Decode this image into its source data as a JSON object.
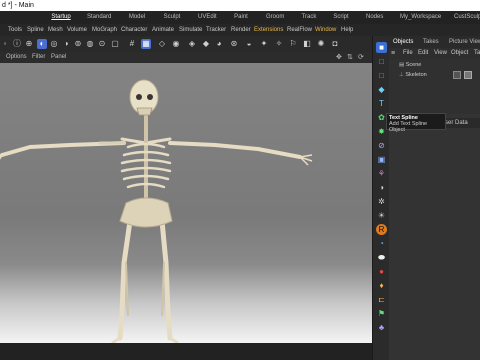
{
  "window": {
    "title": "d *] - Main"
  },
  "layout_tabs": [
    "Startup",
    "Standard",
    "Model",
    "Sculpt",
    "UVEdit",
    "Paint",
    "Groom",
    "Track",
    "Script",
    "Nodes",
    "My_Workspace",
    "CustSculpt"
  ],
  "active_layout": "Startup",
  "menu": [
    "Tools",
    "Spline",
    "Mesh",
    "Volume",
    "MoGraph",
    "Character",
    "Animate",
    "Simulate",
    "Tracker",
    "Render",
    "Extensions",
    "RealFlow",
    "Window",
    "Help"
  ],
  "viewport_menu": [
    "Options",
    "Filter",
    "Panel"
  ],
  "right_panel": {
    "tabs": [
      "Objects",
      "Takes",
      "Picture Viewer"
    ],
    "menu": [
      "File",
      "Edit",
      "View",
      "Object",
      "Ta"
    ],
    "objects": [
      {
        "name": "Scene"
      },
      {
        "name": "Skeleton"
      }
    ],
    "attr_label": "ser Data"
  },
  "tooltip": {
    "title": "Text Spline",
    "desc": "Add Text Spline Object"
  },
  "colors": {
    "accent": "#4a6fd0",
    "highlight_menu": "#e8b84a",
    "viewport_bg": "#7e7e7e",
    "bone": "#e6dcc4"
  },
  "sidebar_icons": [
    "cube-icon",
    "square-icon",
    "sphere-icon",
    "text-icon",
    "spline-icon",
    "generator-icon",
    "deformer-icon",
    "array-icon",
    "camera-icon",
    "light-icon",
    "material-icon",
    "redshift-icon",
    "render-icon",
    "tag-icon",
    "bone-icon",
    "marker-icon",
    "flag-icon",
    "python-icon"
  ]
}
